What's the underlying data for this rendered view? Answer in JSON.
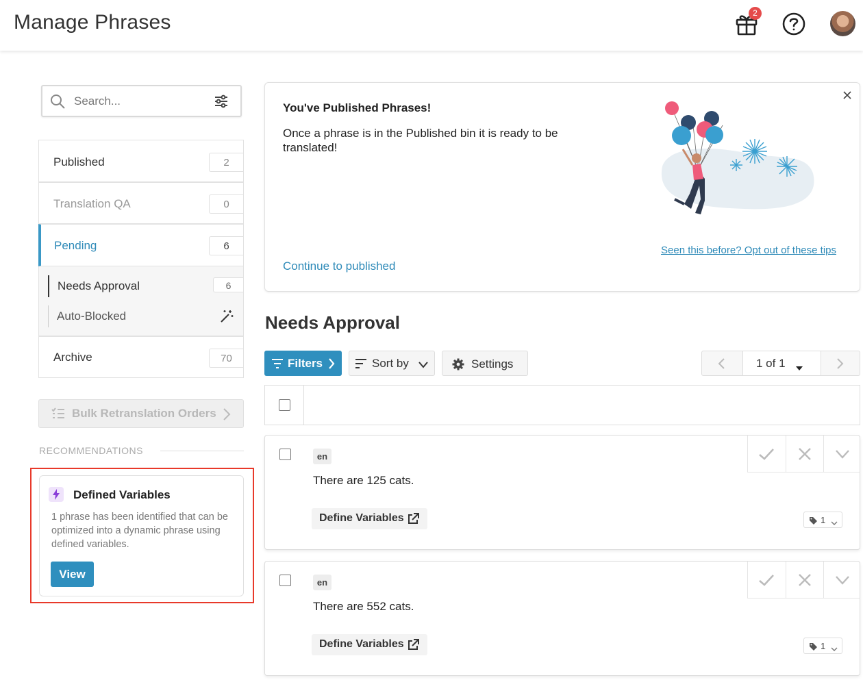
{
  "header": {
    "title": "Manage Phrases",
    "gift_badge": "2",
    "icons": [
      "gift-icon",
      "help-icon",
      "avatar"
    ]
  },
  "sidebar": {
    "search": {
      "placeholder": "Search...",
      "value": ""
    },
    "bins": [
      {
        "label": "Published",
        "count": "2"
      },
      {
        "label": "Translation QA",
        "count": "0"
      },
      {
        "label": "Pending",
        "count": "6"
      },
      {
        "label": "Archive",
        "count": "70"
      }
    ],
    "sub_bins": [
      {
        "label": "Needs Approval",
        "count": "6"
      },
      {
        "label": "Auto-Blocked"
      }
    ],
    "bulk_button": "Bulk Retranslation Orders",
    "recommendations_heading": "RECOMMENDATIONS",
    "recommendation": {
      "title": "Defined Variables",
      "description": "1 phrase has been identified that can be optimized into a dynamic phrase using defined variables.",
      "button": "View"
    }
  },
  "tip": {
    "title": "You've Published Phrases!",
    "body": "Once a phrase is in the Published bin it is ready to be translated!",
    "continue_link": "Continue to published",
    "opt_out_link": "Seen this before? Opt out of these tips"
  },
  "main": {
    "section_title": "Needs Approval",
    "toolbar": {
      "filters": "Filters",
      "sort_by": "Sort by",
      "settings": "Settings",
      "pagination": "1 of 1"
    },
    "phrases": [
      {
        "lang": "en",
        "text": "There are 125 cats.",
        "define_variables": "Define Variables",
        "tag_count": "1"
      },
      {
        "lang": "en",
        "text": "There are 552 cats.",
        "define_variables": "Define Variables",
        "tag_count": "1"
      }
    ]
  },
  "colors": {
    "accent": "#2f8fbe",
    "link": "#2e8ab8",
    "badge": "#e54b4b",
    "highlight_outline": "#e8392a",
    "bolt_bg": "#efe3fb"
  }
}
